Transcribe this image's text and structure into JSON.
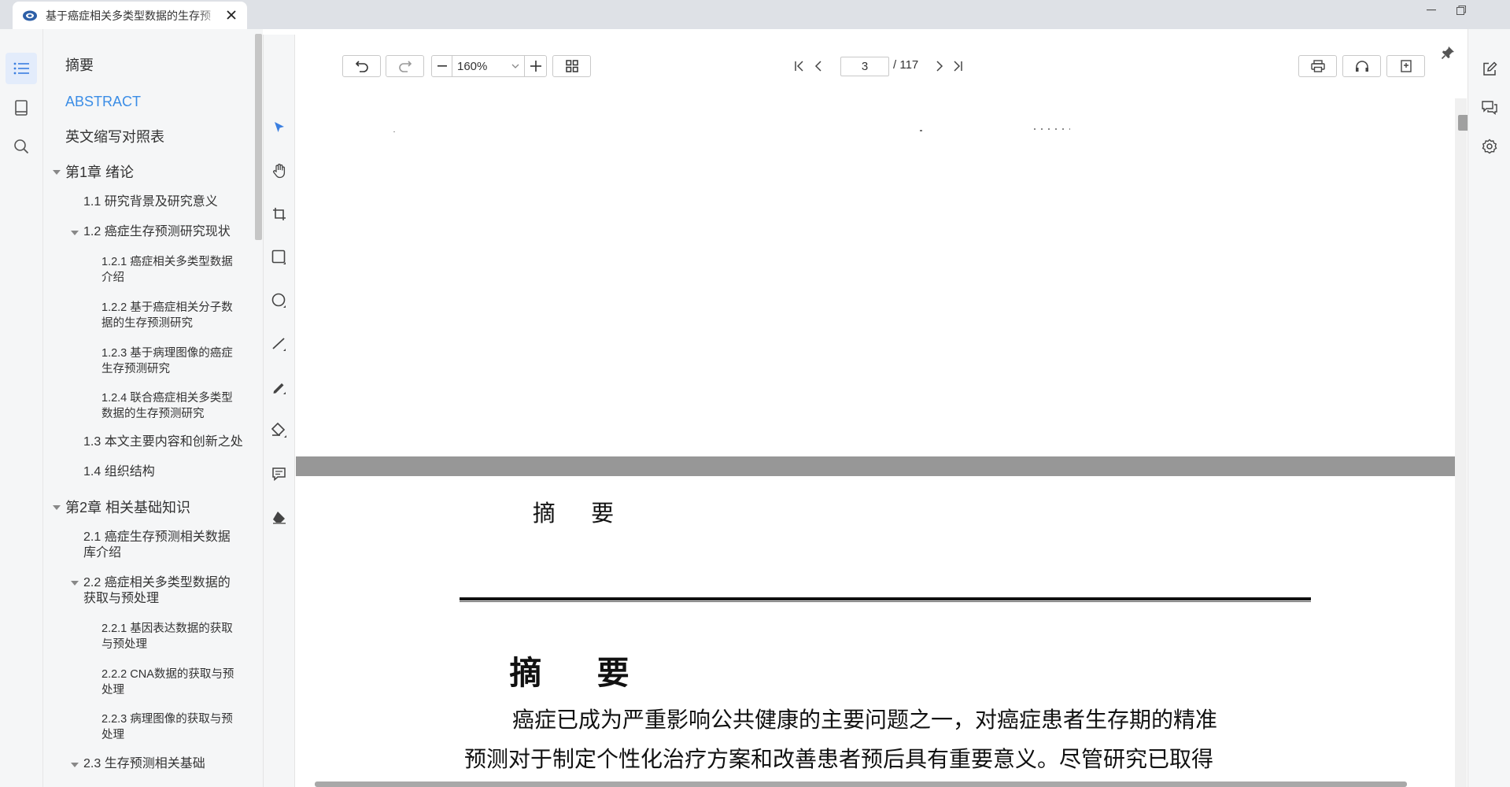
{
  "tab": {
    "title": "基于癌症相关多类型数据的生存预",
    "favicon": "pdf-reader-icon"
  },
  "window_controls": [
    "minimize-icon",
    "restore-icon"
  ],
  "left_rail": {
    "icons": [
      "outline-list-icon",
      "bookmark-book-icon",
      "search-icon"
    ],
    "active": "outline-list-icon"
  },
  "outline": {
    "items": [
      {
        "label": "摘要",
        "level": 0
      },
      {
        "label": "ABSTRACT",
        "level": 0,
        "active": true
      },
      {
        "label": "英文缩写对照表",
        "level": 0
      },
      {
        "label": "第1章 绪论",
        "level": 0,
        "expanded": true
      },
      {
        "label": "1.1 研究背景及研究意义",
        "level": 1
      },
      {
        "label": "1.2 癌症生存预测研究现状",
        "level": 1,
        "expanded": true
      },
      {
        "label": "1.2.1 癌症相关多类型数据介绍",
        "level": 2
      },
      {
        "label": "1.2.2 基于癌症相关分子数据的生存预测研究",
        "level": 2
      },
      {
        "label": "1.2.3 基于病理图像的癌症生存预测研究",
        "level": 2
      },
      {
        "label": "1.2.4 联合癌症相关多类型数据的生存预测研究",
        "level": 2
      },
      {
        "label": "1.3 本文主要内容和创新之处",
        "level": 1
      },
      {
        "label": "1.4 组织结构",
        "level": 1
      },
      {
        "label": "第2章 相关基础知识",
        "level": 0,
        "expanded": true
      },
      {
        "label": "2.1 癌症生存预测相关数据库介绍",
        "level": 1
      },
      {
        "label": "2.2 癌症相关多类型数据的获取与预处理",
        "level": 1,
        "expanded": true
      },
      {
        "label": "2.2.1 基因表达数据的获取与预处理",
        "level": 2
      },
      {
        "label": "2.2.2 CNA数据的获取与预处理",
        "level": 2
      },
      {
        "label": "2.2.3 病理图像的获取与预处理",
        "level": 2
      },
      {
        "label": "2.3 生存预测相关基础",
        "level": 1,
        "expanded": true
      }
    ]
  },
  "tools": [
    "select-arrow-icon",
    "hand-pan-icon",
    "crop-icon",
    "rectangle-icon",
    "circle-icon",
    "line-icon",
    "pen-icon",
    "highlighter-icon",
    "comment-icon",
    "eraser-icon"
  ],
  "toolbar": {
    "zoom_value": "160%",
    "current_page": "3",
    "total_pages": "/ 117"
  },
  "document": {
    "running_head": "摘 要",
    "title": "摘 要",
    "paragraph_lines": [
      "癌症已成为严重影响公共健康的主要问题之一，对癌症患者生存期的精准",
      "预测对于制定个性化治疗方案和改善患者预后具有重要意义。尽管研究已取得"
    ]
  },
  "right_rail": {
    "icons": [
      "edit-annotate-icon",
      "chat-comments-icon",
      "settings-gear-icon"
    ]
  }
}
